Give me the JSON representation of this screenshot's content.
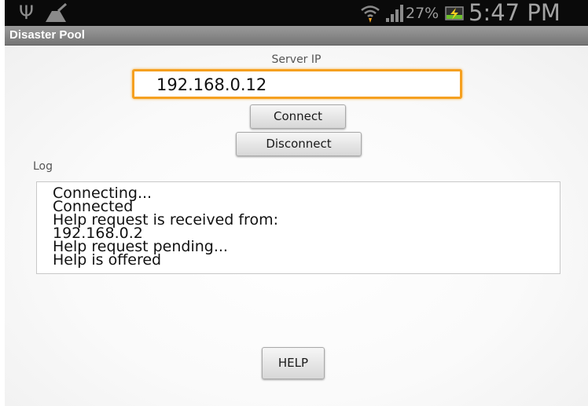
{
  "status_bar": {
    "battery_percent": "27%",
    "time": "5:47 PM",
    "icons": [
      "usb-icon",
      "cleaner-icon",
      "wifi-icon",
      "signal-icon",
      "battery-charging-icon"
    ],
    "colors": {
      "background": "#0a0a0a",
      "battery_fill": "#6bbf2a"
    }
  },
  "app": {
    "title": "Disaster Pool"
  },
  "form": {
    "server_ip_label": "Server IP",
    "server_ip_value": "192.168.0.12",
    "connect_label": "Connect",
    "disconnect_label": "Disconnect",
    "focus_color": "#f5a020"
  },
  "log": {
    "label": "Log",
    "lines": [
      "Connecting...",
      "Connected",
      "Help request is received from:",
      "192.168.0.2",
      "Help request pending...",
      "Help is offered"
    ]
  },
  "help_button": {
    "label": "HELP"
  }
}
